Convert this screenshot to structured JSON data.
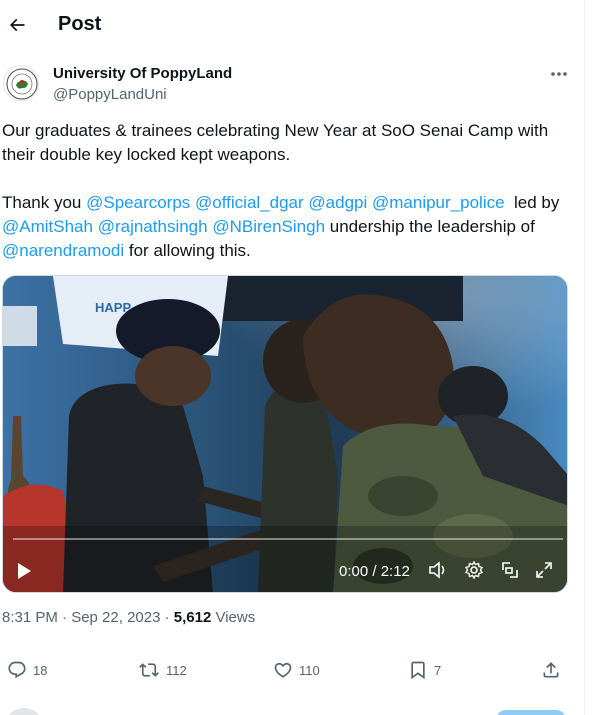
{
  "header": {
    "title": "Post"
  },
  "author": {
    "display_name": "University Of PoppyLand",
    "handle": "@PoppyLandUni"
  },
  "tweet": {
    "line1": "Our graduates & trainees celebrating New Year at SoO Senai Camp with their double key locked kept weapons.",
    "p2_thank": "Thank you ",
    "m1": "@Spearcorps",
    "m2": "@official_dgar",
    "m3": "@adgpi",
    "m4": "@manipur_police",
    "led_by": "  led by",
    "m5": "@AmitShah",
    "m6": "@rajnathsingh",
    "m7": "@NBirenSingh",
    "undership": " undership the leadership of",
    "m8": "@narendramodi",
    "allowing": " for allowing this."
  },
  "video": {
    "time": "0:00 / 2:12",
    "banner_text": "HAPP",
    "progress_fraction": 0.0
  },
  "meta": {
    "time_date": "8:31 PM · Sep 22, 2023 · ",
    "views_count": "5,612",
    "views_label": " Views"
  },
  "actions": {
    "replies": "18",
    "reposts": "112",
    "likes": "110",
    "bookmarks": "7"
  },
  "icons": {
    "back": "arrow-left-icon",
    "more": "more-horizontal-icon",
    "play": "play-icon",
    "volume": "volume-icon",
    "settings": "gear-icon",
    "pip": "picture-in-picture-icon",
    "fullscreen": "fullscreen-icon",
    "reply": "reply-icon",
    "repost": "repost-icon",
    "like": "heart-icon",
    "bookmark": "bookmark-icon",
    "share": "share-icon"
  },
  "colors": {
    "accent": "#1d9bf0",
    "text": "#0f1419",
    "secondary": "#536471"
  }
}
